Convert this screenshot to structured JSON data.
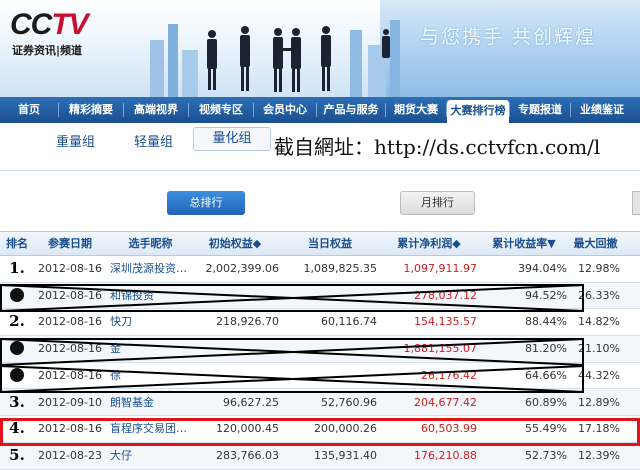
{
  "header": {
    "logo_main_left": "CC",
    "logo_main_red": "TV",
    "logo_subtitle": "证券资讯|频道",
    "slogan": "与您携手  共创辉煌"
  },
  "nav": {
    "items": [
      "首页",
      "精彩摘要",
      "高端视界",
      "视频专区",
      "会员中心",
      "产品与服务",
      "期货大赛",
      "大赛排行榜",
      "专题报道",
      "业绩鉴证"
    ],
    "active": "大赛排行榜"
  },
  "groups": {
    "tab1": "重量组",
    "tab2": "轻量组",
    "tab3": "量化组"
  },
  "watermark": "截自網址：http://ds.cctvfcn.com/l",
  "buttons": {
    "total_rank": "总排行",
    "month_rank": "月排行"
  },
  "table": {
    "headers": [
      "排名",
      "参赛日期",
      "选手昵称",
      "初始权益◆",
      "当日权益",
      "累计净利润◆",
      "累计收益率▼",
      "最大回撤"
    ],
    "rows": [
      {
        "rank": "1.",
        "rank_type": "num",
        "date": "2012-08-16",
        "name": "深圳茂源投资8…",
        "initial": "2,002,399.06",
        "current": "1,089,825.35",
        "net_profit": "1,097,911.97",
        "return": "394.04%",
        "drawdown": "12.98%"
      },
      {
        "rank": "",
        "rank_type": "dot",
        "date": "2012-08-16",
        "name": "和锦投资",
        "initial": "",
        "current": "",
        "net_profit": "278,037.12",
        "return": "94.52%",
        "drawdown": "26.33%"
      },
      {
        "rank": "2.",
        "rank_type": "num",
        "date": "2012-08-16",
        "name": "快刀",
        "initial": "218,926.70",
        "current": "60,116.74",
        "net_profit": "154,135.57",
        "return": "88.44%",
        "drawdown": "14.82%"
      },
      {
        "rank": "",
        "rank_type": "dot",
        "date": "2012-08-16",
        "name": "金",
        "initial": "",
        "current": "",
        "net_profit": "1,881,155.07",
        "return": "81.20%",
        "drawdown": "21.10%"
      },
      {
        "rank": "",
        "rank_type": "dot",
        "date": "2012-08-16",
        "name": "徐",
        "initial": "",
        "current": "",
        "net_profit": "26,176.42",
        "return": "64.66%",
        "drawdown": "44.32%"
      },
      {
        "rank": "3.",
        "rank_type": "num",
        "date": "2012-09-10",
        "name": "朗智基金",
        "initial": "96,627.25",
        "current": "52,760.96",
        "net_profit": "204,677.42",
        "return": "60.89%",
        "drawdown": "12.89%"
      },
      {
        "rank": "4.",
        "rank_type": "num",
        "date": "2012-08-16",
        "name": "盲程序交易团…",
        "initial": "120,000.45",
        "current": "200,000.26",
        "net_profit": "60,503.99",
        "return": "55.49%",
        "drawdown": "17.18%"
      },
      {
        "rank": "5.",
        "rank_type": "num",
        "date": "2012-08-23",
        "name": "大仔",
        "initial": "283,766.03",
        "current": "135,931.40",
        "net_profit": "176,210.88",
        "return": "52.73%",
        "drawdown": "12.39%"
      }
    ]
  },
  "colors": {
    "nav_blue": "#1a4f8f",
    "profit_red": "#d01c1c",
    "highlight_red": "#e0141b"
  }
}
